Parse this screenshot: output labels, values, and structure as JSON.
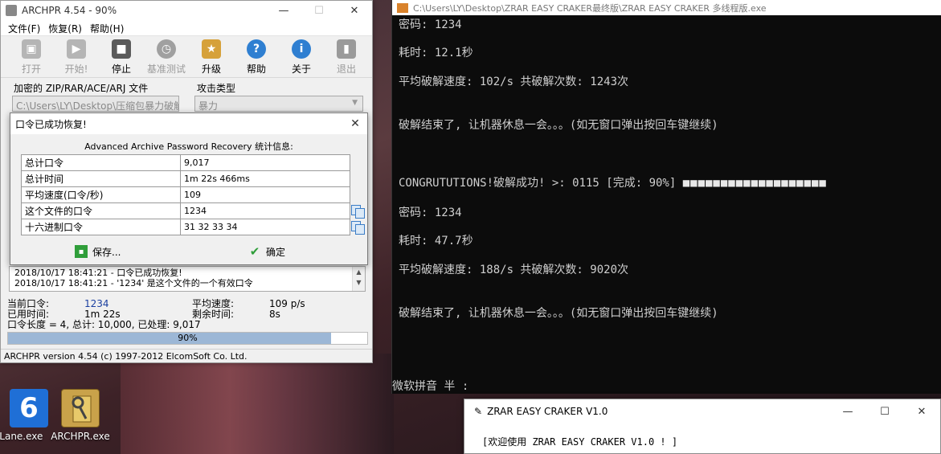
{
  "archpr": {
    "title": "ARCHPR 4.54 - 90%",
    "menu": [
      "文件(F)",
      "恢复(R)",
      "帮助(H)"
    ],
    "toolbar": [
      {
        "label": "打开",
        "icon": "open-icon",
        "enabled": false
      },
      {
        "label": "开始!",
        "icon": "start-icon",
        "enabled": false
      },
      {
        "label": "停止",
        "icon": "stop-icon",
        "enabled": true
      },
      {
        "label": "基准测试",
        "icon": "benchmark-icon",
        "enabled": false
      },
      {
        "label": "升级",
        "icon": "upgrade-icon",
        "enabled": true
      },
      {
        "label": "帮助",
        "icon": "help-icon",
        "enabled": true
      },
      {
        "label": "关于",
        "icon": "about-icon",
        "enabled": true
      },
      {
        "label": "退出",
        "icon": "exit-icon",
        "enabled": false
      }
    ],
    "encrypted_file_label": "加密的 ZIP/RAR/ACE/ARJ 文件",
    "encrypted_file_value": "C:\\Users\\LY\\Desktop\\压缩包暴力破解器",
    "attack_type_label": "攻击类型",
    "attack_type_value": "暴力",
    "log": [
      "2018/10/17 18:41:21 - 口令已成功恢复!",
      "2018/10/17 18:41:21 - '1234' 是这个文件的一个有效口令"
    ],
    "stats": {
      "current_password_label": "当前口令:",
      "current_password": "1234",
      "elapsed_label": "已用时间:",
      "elapsed": "1m 22s",
      "avg_speed_label": "平均速度:",
      "avg_speed": "109 p/s",
      "remaining_label": "剩余时间:",
      "remaining": "8s",
      "length_line": "口令长度 = 4, 总计: 10,000, 已处理: 9,017"
    },
    "progress_percent": 90,
    "progress_text": "90%",
    "status": "ARCHPR version 4.54 (c) 1997-2012 ElcomSoft Co. Ltd."
  },
  "dialog": {
    "title": "口令已成功恢复!",
    "heading": "Advanced Archive Password Recovery 统计信息:",
    "rows": [
      {
        "key": "总计口令",
        "value": "9,017"
      },
      {
        "key": "总计时间",
        "value": "1m 22s 466ms"
      },
      {
        "key": "平均速度(口令/秒)",
        "value": "109"
      },
      {
        "key": "这个文件的口令",
        "value": "1234"
      },
      {
        "key": "十六进制口令",
        "value": "31 32 33 34"
      }
    ],
    "save_label": "保存...",
    "ok_label": "确定"
  },
  "console": {
    "title": "C:\\Users\\LY\\Desktop\\ZRAR EASY CRAKER最终版\\ZRAR EASY CRAKER 多线程版.exe",
    "lines": [
      "密码: 1234",
      "耗时: 12.1秒",
      "平均破解速度: 102/s   共破解次数: 1243次",
      "破解结束了, 让机器休息一会。。。(如无窗口弹出按回车键继续)",
      "CONGRUTUTIONS!破解成功!   >: 0115 [完成: 90%] ",
      "密码: 1234",
      "耗时: 47.7秒",
      "平均破解速度: 188/s   共破解次数: 9020次",
      "破解结束了, 让机器休息一会。。。(如无窗口弹出按回车键继续)",
      "微软拼音 半 :"
    ],
    "progress_blocks": "■■■■■■■■■■■■■■■■■■■"
  },
  "small_window": {
    "title": "ZRAR EASY CRAKER V1.0",
    "body": "[欢迎使用 ZRAR EASY CRAKER V1.0 ! ]"
  },
  "desktop_icons": [
    {
      "label": "ftLane.exe"
    },
    {
      "label": "ARCHPR.exe"
    }
  ],
  "desktop_icon_6": "6"
}
